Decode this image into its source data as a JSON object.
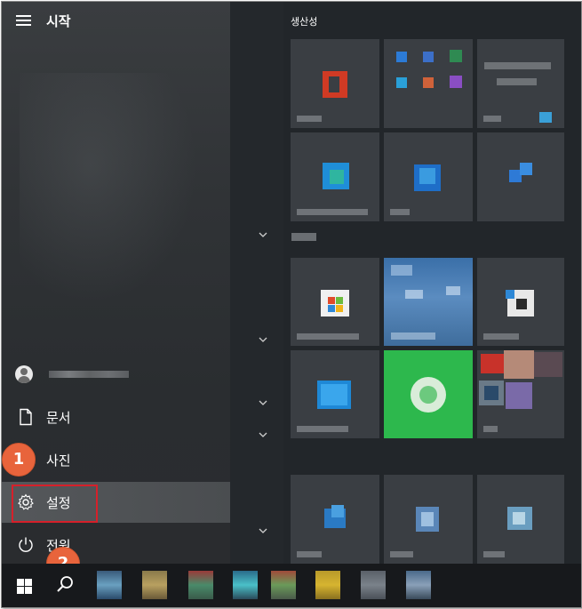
{
  "start_menu": {
    "title": "시작",
    "section_title": "생산성",
    "nav": {
      "documents": "문서",
      "pictures": "사진",
      "settings": "설정",
      "power": "전원"
    }
  },
  "callouts": {
    "one": "1",
    "two": "2"
  },
  "colors": {
    "accent_green": "#2db84d",
    "callout_orange": "#e8643c",
    "highlight_red": "#d6202a",
    "taskbar": "#17191c"
  }
}
